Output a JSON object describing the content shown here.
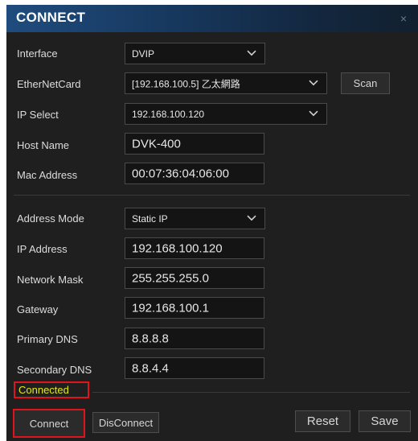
{
  "window": {
    "title": "CONNECT",
    "close_glyph": "×"
  },
  "form": {
    "interface": {
      "label": "Interface",
      "value": "DVIP"
    },
    "ethernet_card": {
      "label": "EtherNetCard",
      "value": "[192.168.100.5] 乙太網路"
    },
    "scan_label": "Scan",
    "ip_select": {
      "label": "IP Select",
      "value": "192.168.100.120"
    },
    "host_name": {
      "label": "Host Name",
      "value": "DVK-400"
    },
    "mac_address": {
      "label": "Mac Address",
      "value": "00:07:36:04:06:00"
    },
    "address_mode": {
      "label": "Address Mode",
      "value": "Static IP"
    },
    "ip_address": {
      "label": "IP Address",
      "value": "192.168.100.120"
    },
    "network_mask": {
      "label": "Network Mask",
      "value": "255.255.255.0"
    },
    "gateway": {
      "label": "Gateway",
      "value": "192.168.100.1"
    },
    "primary_dns": {
      "label": "Primary DNS",
      "value": "8.8.8.8"
    },
    "secondary_dns": {
      "label": "Secondary DNS",
      "value": "8.8.4.4"
    }
  },
  "status": {
    "text": "Connected",
    "color": "#e6e61a"
  },
  "buttons": {
    "connect": "Connect",
    "disconnect": "DisConnect",
    "reset": "Reset",
    "save": "Save"
  },
  "colors": {
    "background": "#1f1f1f",
    "highlight": "#e0141d",
    "title_gradient_start": "#1f4c7e"
  },
  "icons": {
    "dropdown": "chevron-down-icon",
    "close": "close-icon"
  }
}
